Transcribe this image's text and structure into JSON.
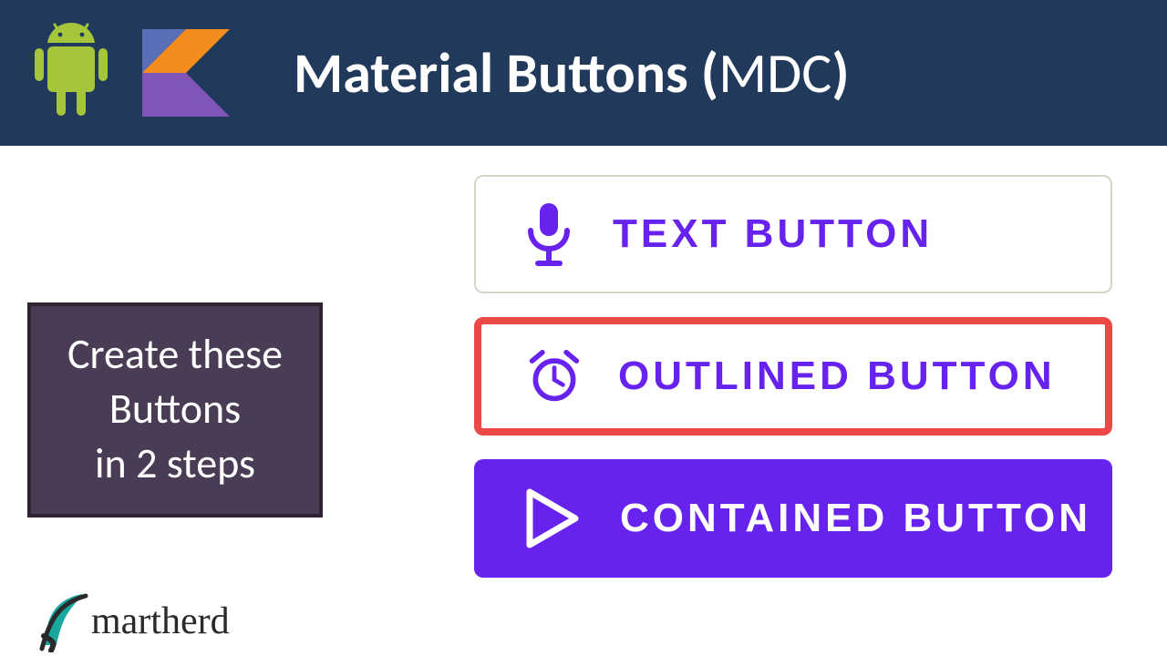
{
  "header": {
    "title_bold": "Material Buttons",
    "title_paren_open": " (",
    "title_light": "MDC",
    "title_paren_close": ")"
  },
  "instruction": {
    "line1": "Create these",
    "line2": "Buttons",
    "line3": "in 2 steps"
  },
  "buttons": {
    "text": {
      "label": "TEXT BUTTON",
      "icon": "microphone-icon"
    },
    "outlined": {
      "label": "OUTLINED BUTTON",
      "icon": "alarm-clock-icon"
    },
    "contained": {
      "label": "CONTAINED BUTTON",
      "icon": "play-icon"
    }
  },
  "brand": {
    "name": "martherd"
  },
  "colors": {
    "accent": "#6722ee",
    "outlined_border": "#ea4947",
    "header_bg": "#213a5c",
    "card_bg": "#4a3c55",
    "android_green": "#a5c63b",
    "kotlin_orange": "#f28c1c",
    "kotlin_blue": "#5a6fb8",
    "kotlin_purple": "#8056b9",
    "brand_teal": "#18a8a0"
  }
}
